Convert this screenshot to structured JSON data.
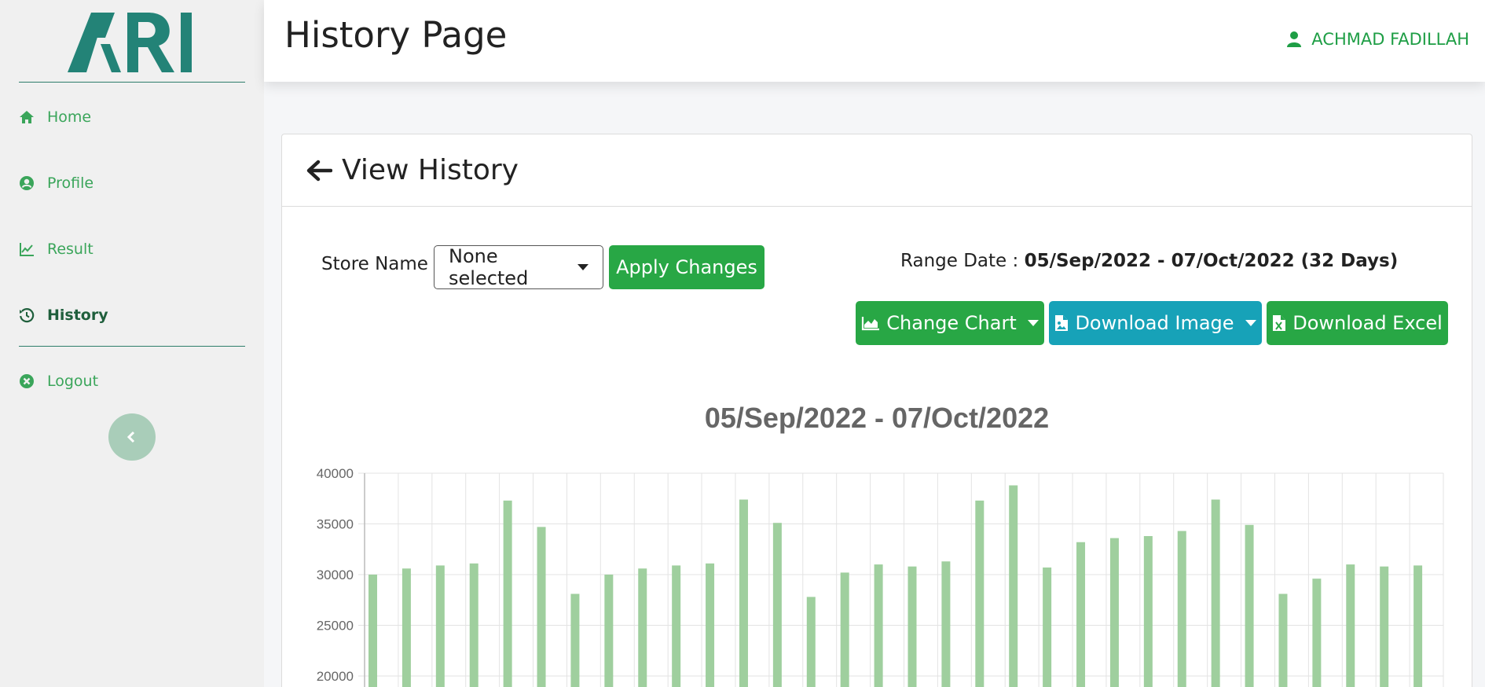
{
  "app": {
    "logo_text": "ARI"
  },
  "sidebar": {
    "items": [
      {
        "label": "Home",
        "icon": "home-icon",
        "active": false
      },
      {
        "label": "Profile",
        "icon": "user-circle-icon",
        "active": false
      },
      {
        "label": "Result",
        "icon": "line-chart-icon",
        "active": false
      },
      {
        "label": "History",
        "icon": "history-icon",
        "active": true
      },
      {
        "label": "Logout",
        "icon": "times-circle-icon",
        "active": false
      }
    ]
  },
  "header": {
    "title": "History Page",
    "user_name": "ACHMAD FADILLAH"
  },
  "card": {
    "title": "View History",
    "store_label": "Store Name :",
    "store_select_value": "None selected",
    "apply_label": "Apply Changes",
    "range_label": "Range Date : ",
    "range_value": "05/Sep/2022 - 07/Oct/2022 (32 Days)",
    "change_chart_label": "Change Chart",
    "download_image_label": "Download Image",
    "download_excel_label": "Download Excel"
  },
  "colors": {
    "accent_green": "#28a745",
    "info_blue": "#17a2b8",
    "bar_green": "#9fcf9e",
    "sidebar_text": "#3aa55a"
  },
  "chart_data": {
    "type": "bar",
    "title": "05/Sep/2022 - 07/Oct/2022",
    "xlabel": "",
    "ylabel": "",
    "y_ticks": [
      40000,
      35000,
      30000,
      25000,
      20000
    ],
    "ylim": [
      15000,
      40000
    ],
    "grid": true,
    "values": [
      30000,
      30600,
      30900,
      31100,
      37300,
      34700,
      28100,
      30000,
      30600,
      30900,
      31100,
      37400,
      35100,
      27800,
      30200,
      31000,
      30800,
      31300,
      37300,
      38800,
      30700,
      33200,
      33600,
      33800,
      34300,
      37400,
      34900,
      28100,
      29600,
      31000,
      30800,
      30900
    ]
  }
}
